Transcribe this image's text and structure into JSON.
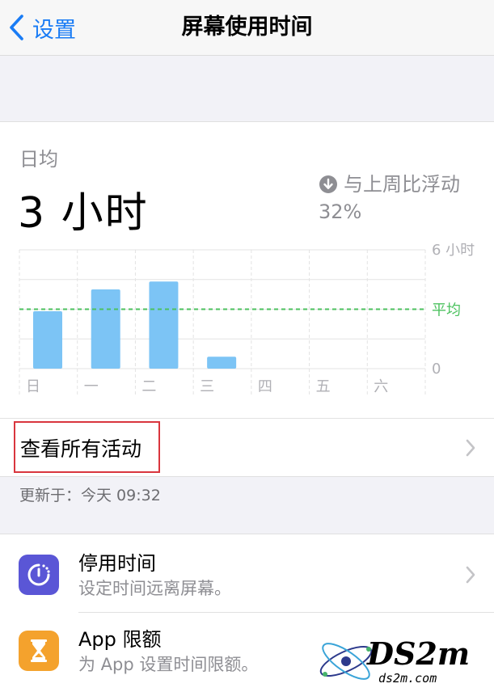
{
  "nav": {
    "back_label": "设置",
    "title": "屏幕使用时间"
  },
  "summary": {
    "daily_label": "日均",
    "daily_value": "3 小时",
    "compare_text": "与上周比浮动",
    "compare_pct": "32%"
  },
  "chart_data": {
    "type": "bar",
    "categories": [
      "日",
      "一",
      "二",
      "三",
      "四",
      "五",
      "六"
    ],
    "values": [
      2.9,
      4.0,
      4.4,
      0.6,
      0,
      0,
      0
    ],
    "ylim": [
      0,
      6
    ],
    "y_tick_labels": [
      "6 小时",
      "0"
    ],
    "average": 3.0,
    "average_label": "平均",
    "bar_color": "#7cc4f5",
    "average_color": "#4cc25f",
    "grid": true
  },
  "activity": {
    "label": "查看所有活动"
  },
  "updated": "更新于：今天 09:32",
  "items": [
    {
      "title": "停用时间",
      "subtitle": "设定时间远离屏幕。",
      "icon": "downtime-icon",
      "color": "#5a56d6"
    },
    {
      "title": "App 限额",
      "subtitle": "为 App 设置时间限额。",
      "icon": "hourglass-icon",
      "color": "#f4a22d"
    }
  ],
  "watermark": {
    "text": "DS2m",
    "sub": "ds2m.com"
  }
}
